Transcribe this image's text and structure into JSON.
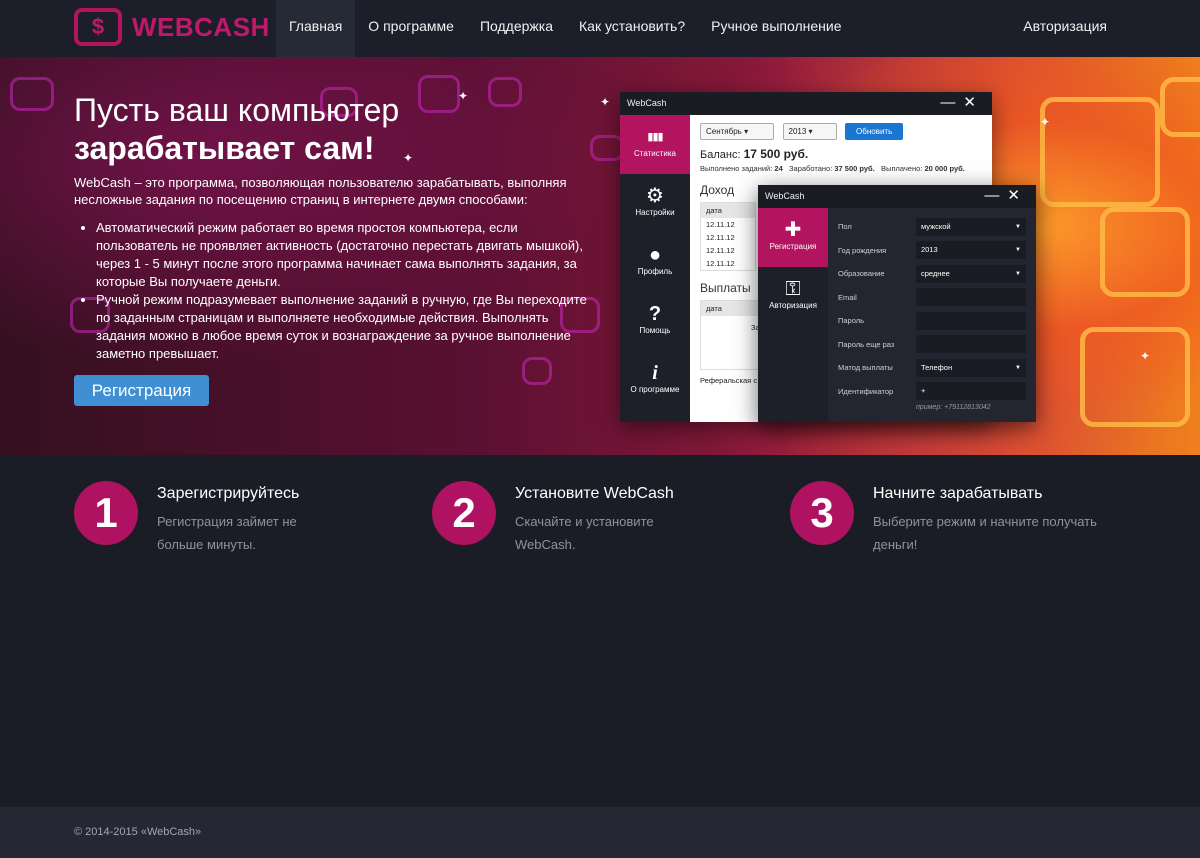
{
  "brand": {
    "logo_glyph": "$",
    "name": "WEBCASH",
    "color": "#c2176a"
  },
  "nav": {
    "items": [
      "Главная",
      "О программе",
      "Поддержка",
      "Как установить?",
      "Ручное выполнение"
    ],
    "active_index": 0,
    "login": "Авторизация"
  },
  "hero": {
    "title_line1": "Пусть ваш компьютер",
    "title_line2": "зарабатывает сам!",
    "description": "WebCash – это программа, позволяющая пользователю зарабатывать, выполняя несложные задания по посещению страниц в интернете двумя способами:",
    "bullets": [
      "Автоматический режим работает во время простоя компьютера, если пользователь не проявляет активность (достаточно перестать двигать мышкой), через 1 - 5 минут после этого программа начинает сама выполнять задания, за которые Вы получаете деньги.",
      "Ручной режим подразумевает выполнение заданий в ручную, где Вы переходите по заданным страницам и выполняете необходимые действия. Выполнять задания можно в любое время суток и вознаграждение за ручное выполнение заметно превышает."
    ],
    "register_button": "Регистрация"
  },
  "app_main": {
    "title": "WebCash",
    "sidebar": [
      {
        "icon": "bar-chart-icon",
        "glyph": "▮▮▮",
        "label": "Статистика"
      },
      {
        "icon": "gear-icon",
        "glyph": "⚙",
        "label": "Настройки"
      },
      {
        "icon": "user-icon",
        "glyph": "●",
        "label": "Профиль"
      },
      {
        "icon": "help-icon",
        "glyph": "?",
        "label": "Помощь"
      },
      {
        "icon": "info-icon",
        "glyph": "i",
        "label": "О программе"
      }
    ],
    "month": "Сентябрь",
    "year": "2013",
    "refresh": "Обновить",
    "balance_label": "Баланс:",
    "balance_value": "17 500 руб.",
    "stats_done_label": "Выполнено заданий:",
    "stats_done_value": "24",
    "stats_earned_label": "Заработано:",
    "stats_earned_value": "37 500 руб.",
    "stats_paid_label": "Выплачено:",
    "stats_paid_value": "20 000 руб.",
    "income_title": "Доход",
    "date_header": "дата",
    "income_rows": [
      "12.11.12",
      "12.11.12",
      "12.11.12",
      "12.11.12"
    ],
    "payouts_title": "Выплаты",
    "payouts_fragment": "За",
    "referral": "Реферальская с"
  },
  "app_reg": {
    "title": "WebCash",
    "sidebar": [
      {
        "icon": "add-user-icon",
        "glyph": "✚",
        "label": "Регистрация"
      },
      {
        "icon": "key-icon",
        "glyph": "⚿",
        "label": "Авторизация"
      }
    ],
    "fields": [
      {
        "label": "Пол",
        "value": "мужской",
        "dropdown": true
      },
      {
        "label": "Год рождения",
        "value": "2013",
        "dropdown": true
      },
      {
        "label": "Образование",
        "value": "среднее",
        "dropdown": true
      },
      {
        "label": "Email",
        "value": "",
        "dropdown": false
      },
      {
        "label": "Пароль",
        "value": "",
        "dropdown": false
      },
      {
        "label": "Пароль еще раз",
        "value": "",
        "dropdown": false
      },
      {
        "label": "Матод выплаты",
        "value": "Телефон",
        "dropdown": true
      },
      {
        "label": "Идентификатор",
        "value": "+",
        "dropdown": false
      }
    ],
    "hint": "пример: +79112813042"
  },
  "steps": [
    {
      "num": "1",
      "title": "Зарегистрируйтесь",
      "text": "Регистрация займет не больше минуты."
    },
    {
      "num": "2",
      "title": "Установите WebCash",
      "text": "Скачайте и установите WebCash."
    },
    {
      "num": "3",
      "title": "Начните зарабатывать",
      "text": "Выберите режим и начните получать деньги!"
    }
  ],
  "footer": {
    "copyright": "© 2014-2015 «WebCash»"
  },
  "colors": {
    "accent": "#ae1260",
    "button_blue": "#3f8fd2",
    "background": "#1b1d26"
  }
}
